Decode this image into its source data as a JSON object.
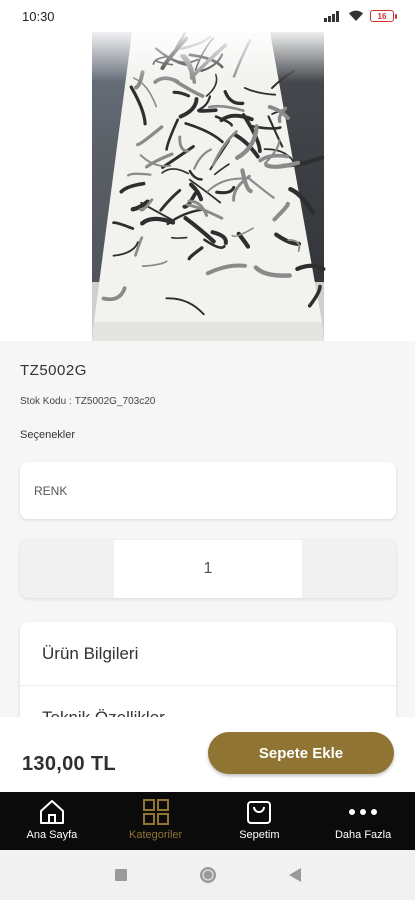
{
  "status_bar": {
    "time": "10:30",
    "battery": "16"
  },
  "product": {
    "name": "TZ5002G",
    "stock_label": "Stok Kodu :",
    "stock_code": "TZ5002G_703c20",
    "options_label": "Seçenekler",
    "color_select_placeholder": "RENK",
    "quantity": "1"
  },
  "info_sections": [
    {
      "label": "Ürün Bilgileri"
    },
    {
      "label": "Teknik Özellikler"
    }
  ],
  "cart": {
    "price": "130,00 TL",
    "add_button": "Sepete Ekle"
  },
  "tabs": [
    {
      "label": "Ana Sayfa",
      "icon": "home-icon"
    },
    {
      "label": "Kategoriler",
      "icon": "grid-icon",
      "active": true
    },
    {
      "label": "Sepetim",
      "icon": "shopping-bag-icon"
    },
    {
      "label": "Daha Fazla",
      "icon": "more-dots-icon"
    }
  ],
  "colors": {
    "accent": "#8f7433",
    "tabbar": "#0b0b0b"
  }
}
